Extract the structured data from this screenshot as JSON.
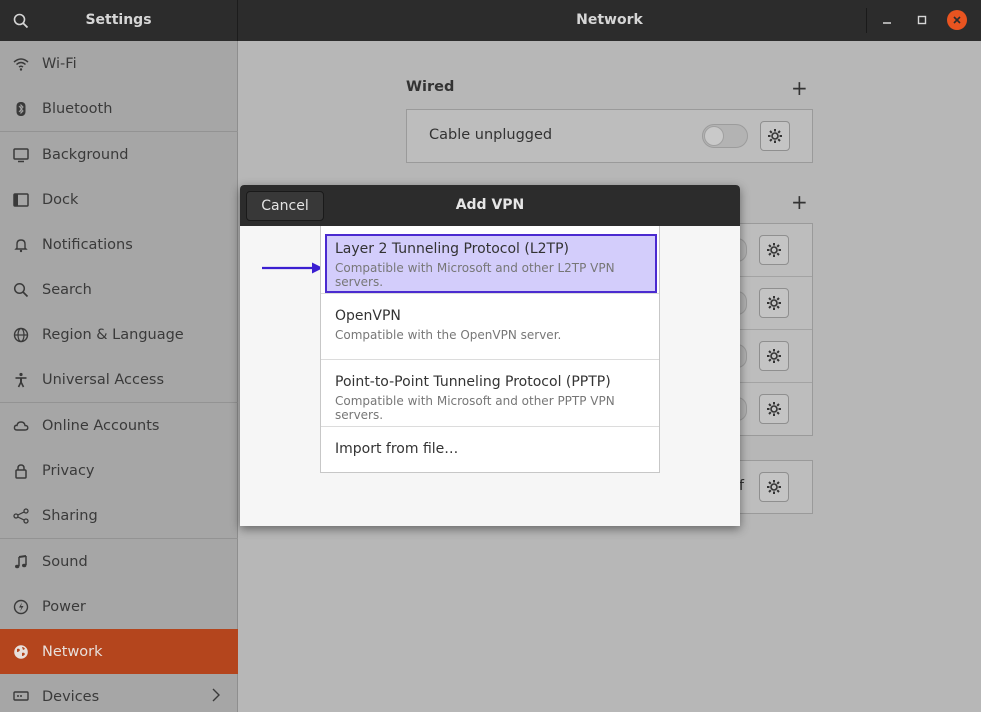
{
  "app": {
    "sidebar_title": "Settings",
    "page_title": "Network"
  },
  "sidebar": {
    "items": [
      {
        "label": "Wi-Fi",
        "icon": "wifi-icon"
      },
      {
        "label": "Bluetooth",
        "icon": "bluetooth-icon"
      },
      {
        "label": "Background",
        "icon": "background-icon"
      },
      {
        "label": "Dock",
        "icon": "dock-icon"
      },
      {
        "label": "Notifications",
        "icon": "bell-icon"
      },
      {
        "label": "Search",
        "icon": "search-icon"
      },
      {
        "label": "Region & Language",
        "icon": "globe-icon"
      },
      {
        "label": "Universal Access",
        "icon": "accessibility-icon"
      },
      {
        "label": "Online Accounts",
        "icon": "cloud-icon"
      },
      {
        "label": "Privacy",
        "icon": "lock-icon"
      },
      {
        "label": "Sharing",
        "icon": "share-icon"
      },
      {
        "label": "Sound",
        "icon": "music-note-icon"
      },
      {
        "label": "Power",
        "icon": "power-icon"
      },
      {
        "label": "Network",
        "icon": "network-icon",
        "active": true
      },
      {
        "label": "Devices",
        "icon": "devices-icon"
      }
    ]
  },
  "main": {
    "wired": {
      "title": "Wired",
      "connection_label": "Cable unplugged"
    },
    "partial_text": "ff"
  },
  "dialog": {
    "title": "Add VPN",
    "cancel_label": "Cancel",
    "options": [
      {
        "name": "Layer 2 Tunneling Protocol (L2TP)",
        "desc": "Compatible with Microsoft and other L2TP VPN servers.",
        "selected": true
      },
      {
        "name": "OpenVPN",
        "desc": "Compatible with the OpenVPN server."
      },
      {
        "name": "Point-to-Point Tunneling Protocol (PPTP)",
        "desc": "Compatible with Microsoft and other PPTP VPN servers."
      },
      {
        "name": "Import from file…",
        "desc": ""
      }
    ]
  },
  "colors": {
    "accent": "#e95420",
    "sidebar_active": "#b4451d",
    "selection_fill": "#d3cdfb",
    "selection_border": "#4b2bd0",
    "header_bg": "#2c2c2c"
  }
}
